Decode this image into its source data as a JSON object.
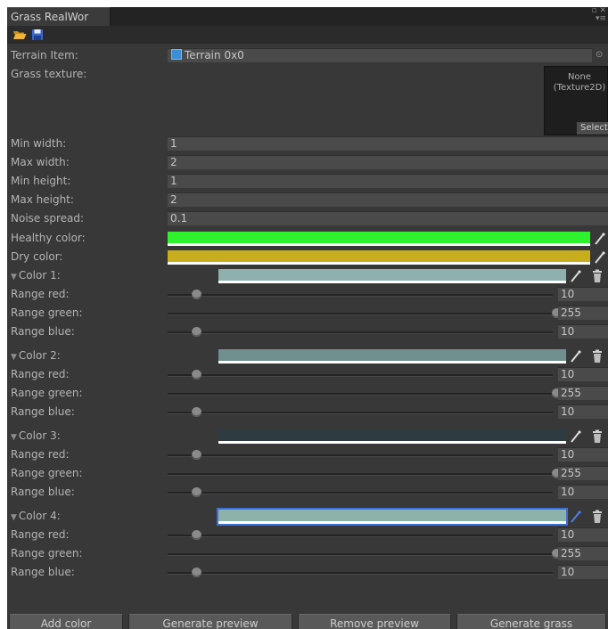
{
  "window": {
    "tab_title": "Grass RealWor"
  },
  "toolbar": {
    "open_icon": "folder-open-icon",
    "save_icon": "floppy-disk-icon"
  },
  "fields": {
    "terrain_item": {
      "label": "Terrain Item:",
      "value": "Terrain 0x0"
    },
    "grass_texture": {
      "label": "Grass texture:",
      "value_line1": "None",
      "value_line2": "(Texture2D)",
      "select_label": "Select"
    },
    "min_width": {
      "label": "Min width:",
      "value": "1"
    },
    "max_width": {
      "label": "Max width:",
      "value": "2"
    },
    "min_height": {
      "label": "Min height:",
      "value": "1"
    },
    "max_height": {
      "label": "Max height:",
      "value": "2"
    },
    "noise_spread": {
      "label": "Noise spread:",
      "value": "0.1"
    },
    "healthy_color": {
      "label": "Healthy color:",
      "color": "#2ef22e"
    },
    "dry_color": {
      "label": "Dry color:",
      "color": "#c8ae1e"
    }
  },
  "colors": [
    {
      "label": "Color 1:",
      "color": "#8fb1ad",
      "selected": false,
      "ranges": [
        {
          "label": "Range red:",
          "value": "10",
          "fraction": 0.04
        },
        {
          "label": "Range green:",
          "value": "255",
          "fraction": 1.0
        },
        {
          "label": "Range blue:",
          "value": "10",
          "fraction": 0.04
        }
      ]
    },
    {
      "label": "Color 2:",
      "color": "#6f908e",
      "selected": false,
      "ranges": [
        {
          "label": "Range red:",
          "value": "10",
          "fraction": 0.04
        },
        {
          "label": "Range green:",
          "value": "255",
          "fraction": 1.0
        },
        {
          "label": "Range blue:",
          "value": "10",
          "fraction": 0.04
        }
      ]
    },
    {
      "label": "Color 3:",
      "color": "#2e3b41",
      "selected": false,
      "ranges": [
        {
          "label": "Range red:",
          "value": "10",
          "fraction": 0.04
        },
        {
          "label": "Range green:",
          "value": "255",
          "fraction": 1.0
        },
        {
          "label": "Range blue:",
          "value": "10",
          "fraction": 0.04
        }
      ]
    },
    {
      "label": "Color 4:",
      "color": "#8db2aa",
      "selected": true,
      "ranges": [
        {
          "label": "Range red:",
          "value": "10",
          "fraction": 0.04
        },
        {
          "label": "Range green:",
          "value": "255",
          "fraction": 1.0
        },
        {
          "label": "Range blue:",
          "value": "10",
          "fraction": 0.04
        }
      ]
    }
  ],
  "buttons": {
    "add_color": "Add color",
    "generate_preview": "Generate preview",
    "remove_preview": "Remove preview",
    "generate_grass": "Generate grass"
  }
}
